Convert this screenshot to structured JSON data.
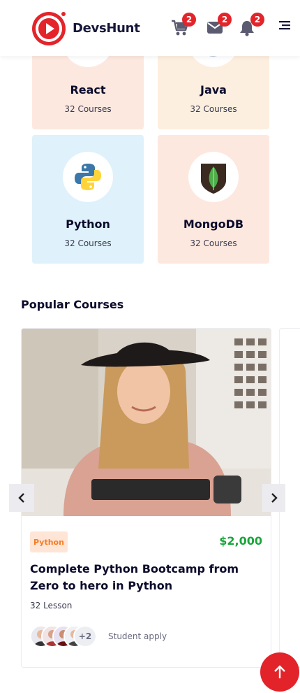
{
  "header": {
    "brand": "DevsHunt",
    "cart_count": "2",
    "mail_count": "2",
    "notif_count": "2"
  },
  "categories": [
    {
      "name": "React",
      "count": "32 Courses",
      "bg": "#fde8df",
      "icon": "react-icon"
    },
    {
      "name": "Java",
      "count": "32 Courses",
      "bg": "#fdefdf",
      "icon": "java-icon"
    },
    {
      "name": "Python",
      "count": "32 Courses",
      "bg": "#dff1fa",
      "icon": "python-icon"
    },
    {
      "name": "MongoDB",
      "count": "32 Courses",
      "bg": "#fde8df",
      "icon": "mongodb-icon"
    }
  ],
  "popular": {
    "title": "Popular Courses",
    "course": {
      "tag": "Python",
      "price": "$2,000",
      "title": "Complete Python Bootcamp from Zero to hero in Python",
      "lessons": "32 Lesson",
      "more_students": "+2",
      "apply_label": "Student apply"
    }
  },
  "colors": {
    "brand_red": "#e3242b",
    "price_green": "#1aa53b",
    "tag_orange": "#f57c24"
  }
}
